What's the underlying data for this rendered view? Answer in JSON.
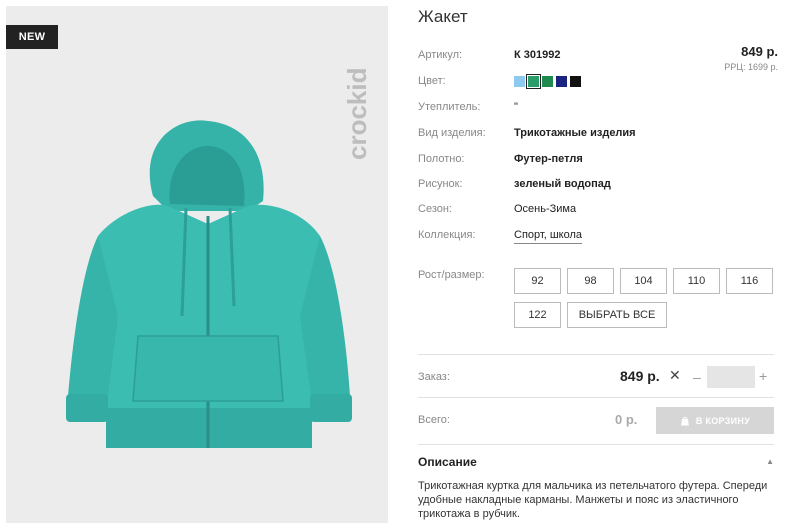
{
  "product": {
    "badge": "NEW",
    "brand": "crockid",
    "title": "Жакет",
    "price": "849 р.",
    "rrp": "РРЦ: 1699 р."
  },
  "specs": [
    {
      "label": "Артикул:",
      "value": "К 301992"
    },
    {
      "label": "Цвет:",
      "value": ""
    },
    {
      "label": "Утеплитель:",
      "value": "\""
    },
    {
      "label": "Вид изделия:",
      "value": "Трикотажные изделия"
    },
    {
      "label": "Полотно:",
      "value": "Футер-петля"
    },
    {
      "label": "Рисунок:",
      "value": "зеленый водопад"
    },
    {
      "label": "Сезон:",
      "value": "Осень-Зима"
    },
    {
      "label": "Коллекция:",
      "value": "Спорт, школа"
    }
  ],
  "colors": [
    "#8ec9ef",
    "#2a9d6b",
    "#1f8a4c",
    "#1a237e",
    "#111111"
  ],
  "selected_color": 1,
  "sizes": {
    "label": "Рост/размер:",
    "options": [
      "92",
      "98",
      "104",
      "110",
      "116",
      "122"
    ],
    "select_all": "ВЫБРАТЬ ВСЕ"
  },
  "order": {
    "label": "Заказ:",
    "price": "849 р.",
    "times": "✕",
    "minus": "–",
    "plus": "+",
    "quantity": ""
  },
  "total": {
    "label": "Всего:",
    "value": "0 р.",
    "cart_button": "В КОРЗИНУ"
  },
  "description": {
    "heading": "Описание",
    "toggle": "▲",
    "text": "Трикотажная куртка для мальчика из петельчатого футера. Спереди удобные накладные карманы. Манжеты и пояс из эластичного трикотажа в рубчик."
  }
}
